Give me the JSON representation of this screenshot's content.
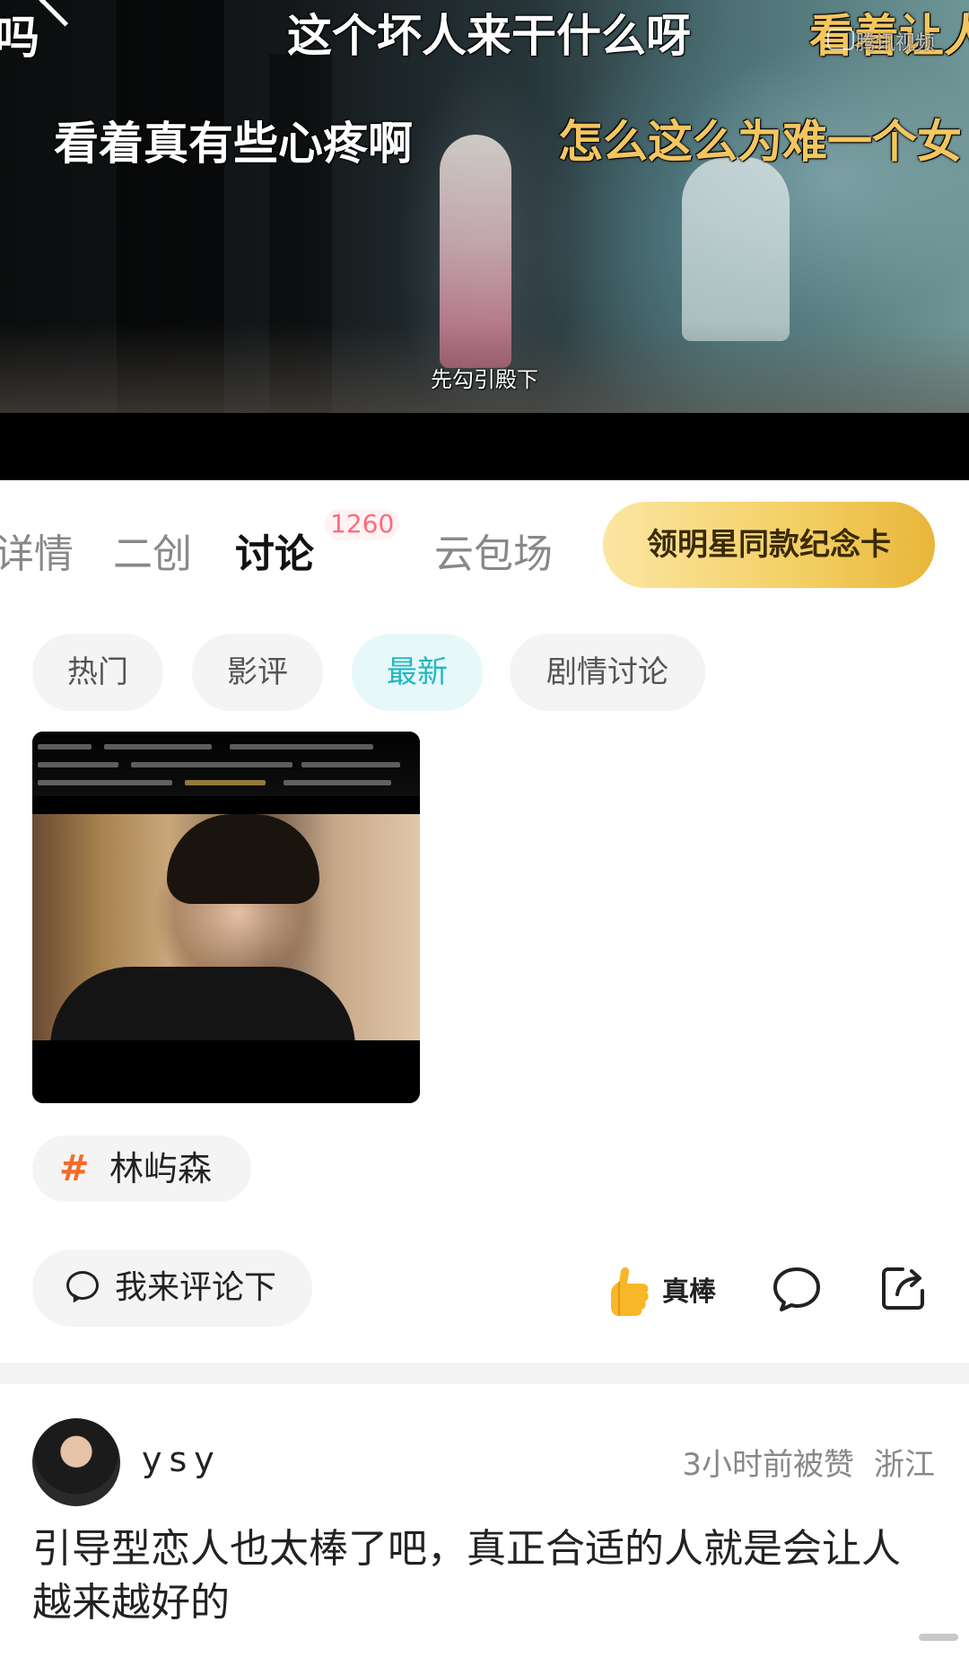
{
  "player": {
    "danmu": [
      {
        "text": "这个坏人来干什么呀",
        "color": "white"
      },
      {
        "text": "看着让人",
        "color": "gold"
      },
      {
        "text": "看着真有些心疼啊",
        "color": "white"
      },
      {
        "text": "怎么这么为难一个女",
        "color": "gold"
      },
      {
        "text": "吗",
        "color": "white"
      }
    ],
    "subtitle": "先勾引殿下",
    "watermark": "腾讯视频"
  },
  "tabs": {
    "items": [
      {
        "label": "详情"
      },
      {
        "label": "二创"
      },
      {
        "label": "讨论",
        "active": true
      },
      {
        "label": "云包场"
      }
    ],
    "badge": "1260",
    "card_button": "领明星同款纪念卡"
  },
  "filters": {
    "items": [
      {
        "label": "热门"
      },
      {
        "label": "影评"
      },
      {
        "label": "最新",
        "active": true
      },
      {
        "label": "剧情讨论"
      }
    ]
  },
  "post": {
    "tag": {
      "hash": "#",
      "label": "林屿森"
    },
    "comment_placeholder": "我来评论下",
    "like_label": "真棒"
  },
  "comment": {
    "username": "ysy",
    "time": "3小时前被赞",
    "location": "浙江",
    "text": "引导型恋人也太棒了吧，真正合适的人就是会让人越来越好的"
  }
}
